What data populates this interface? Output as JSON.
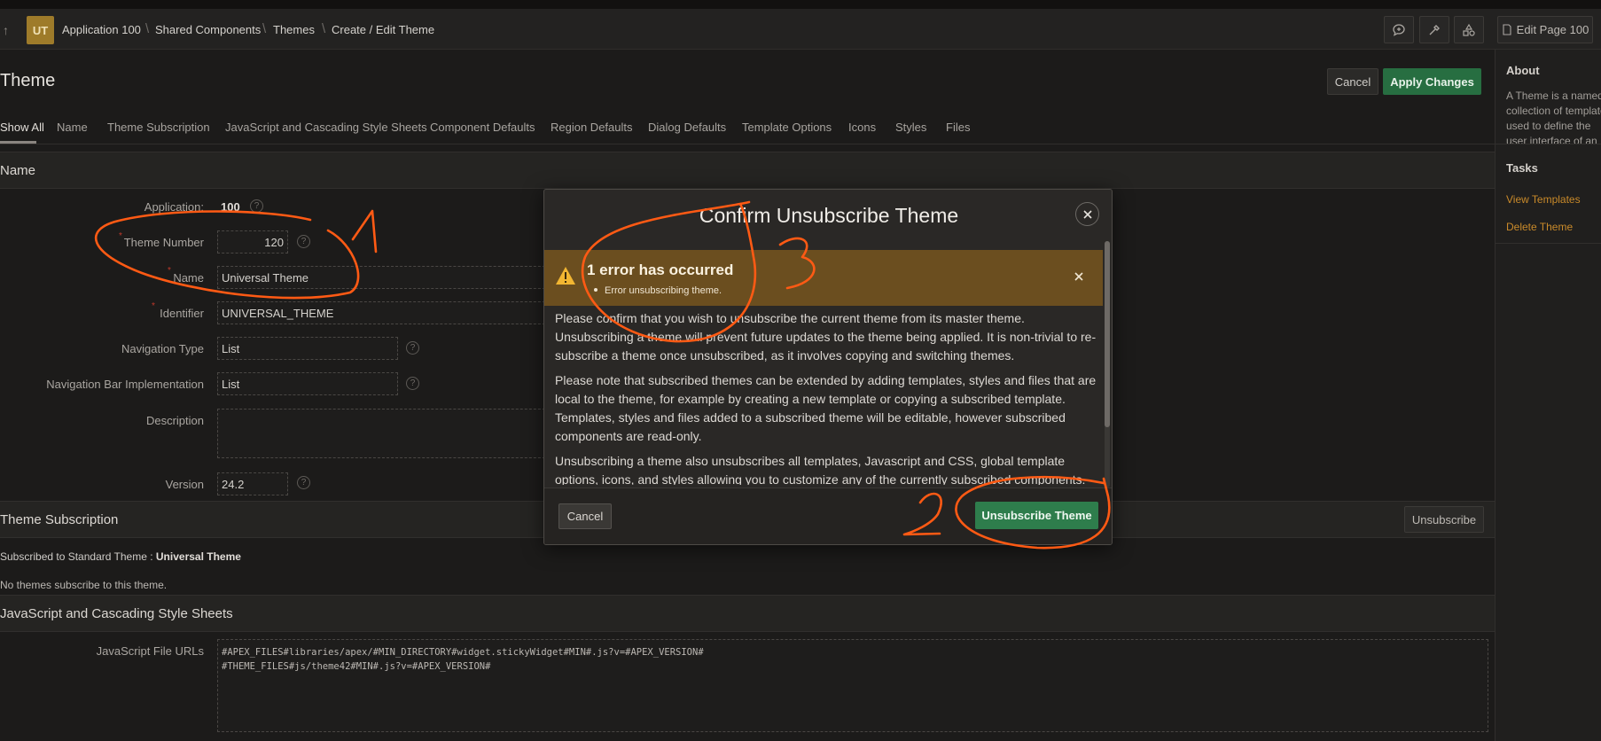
{
  "header": {
    "badge": "UT",
    "breadcrumbs": [
      "Application 100",
      "Shared Components",
      "Themes",
      "Create / Edit Theme"
    ],
    "edit_page": "Edit Page 100"
  },
  "page": {
    "title": "Theme",
    "cancel": "Cancel",
    "apply": "Apply Changes",
    "tabs": [
      "Show All",
      "Name",
      "Theme Subscription",
      "JavaScript and Cascading Style Sheets",
      "Component Defaults",
      "Region Defaults",
      "Dialog Defaults",
      "Template Options",
      "Icons",
      "Styles",
      "Files"
    ]
  },
  "name_region": {
    "title": "Name",
    "application_label": "Application:",
    "application_value": "100",
    "theme_number_label": "Theme Number",
    "theme_number": "120",
    "name_label": "Name",
    "name": "Universal Theme",
    "identifier_label": "Identifier",
    "identifier": "UNIVERSAL_THEME",
    "nav_type_label": "Navigation Type",
    "nav_type": "List",
    "nav_bar_label": "Navigation Bar Implementation",
    "nav_bar": "List",
    "description_label": "Description",
    "version_label": "Version",
    "version": "24.2"
  },
  "subscription": {
    "title": "Theme Subscription",
    "unsubscribe": "Unsubscribe",
    "subscribed_prefix": "Subscribed to Standard Theme : ",
    "subscribed_theme": "Universal Theme",
    "no_subscribers": "No themes subscribe to this theme."
  },
  "js_region": {
    "title": "JavaScript and Cascading Style Sheets",
    "js_label": "JavaScript File URLs",
    "js_line1": "#APEX_FILES#libraries/apex/#MIN_DIRECTORY#widget.stickyWidget#MIN#.js?v=#APEX_VERSION#",
    "js_line2": "#THEME_FILES#js/theme42#MIN#.js?v=#APEX_VERSION#"
  },
  "sidebar": {
    "about_title": "About",
    "about_text": "A Theme is a named collection of templates used to define the user interface of an",
    "tasks_title": "Tasks",
    "task1": "View Templates",
    "task2": "Delete Theme"
  },
  "dialog": {
    "title": "Confirm Unsubscribe Theme",
    "alert_title": "1 error has occurred",
    "alert_message": "Error unsubscribing theme.",
    "p1": "Please confirm that you wish to unsubscribe the current theme from its master theme. Unsubscribing a theme will prevent future updates to the theme being applied. It is non-trivial to re-subscribe a theme once unsubscribed, as it involves copying and switching themes.",
    "p2": "Please note that subscribed themes can be extended by adding templates, styles and files that are local to the theme, for example by creating a new template or copying a subscribed template. Templates, styles and files added to a subscribed theme will be editable, however subscribed components are read-only.",
    "p3": "Unsubscribing a theme also unsubscribes all templates, Javascript and CSS, global template options, icons, and styles allowing you to customize any of the currently subscribed components.",
    "cancel": "Cancel",
    "confirm": "Unsubscribe Theme"
  },
  "annotations": {
    "a1": "1",
    "a2": "2",
    "a3": "3",
    "stroke_color": "#ff5a14"
  }
}
